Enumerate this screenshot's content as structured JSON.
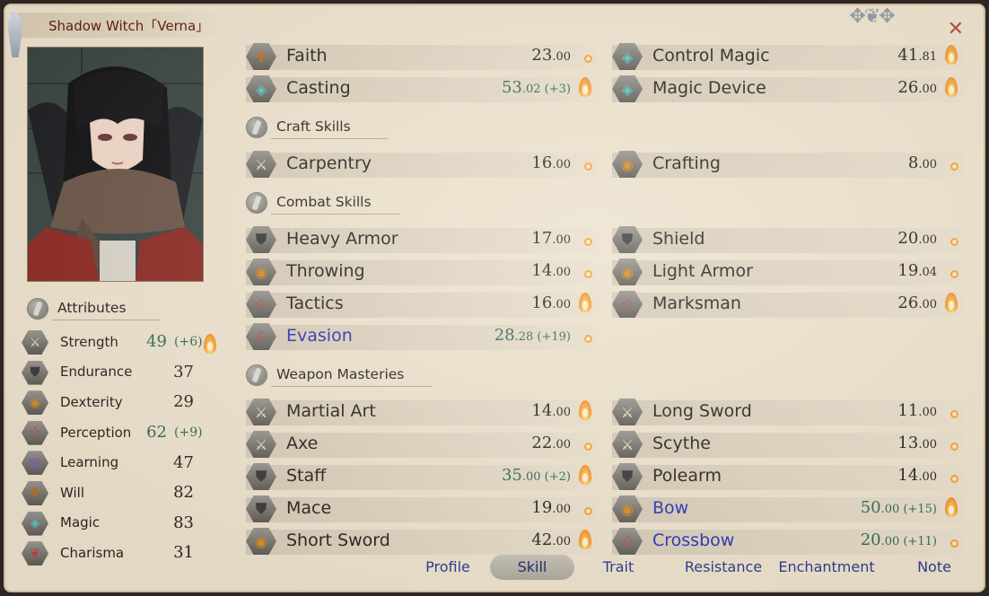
{
  "title": "Shadow Witch「Verna」",
  "attributes_header": "Attributes",
  "attributes": [
    {
      "name": "Strength",
      "value": "49",
      "bonus": "(+6)",
      "icon": "sword-icon",
      "potential": "flame"
    },
    {
      "name": "Endurance",
      "value": "37",
      "bonus": "",
      "icon": "armor-icon",
      "potential": ""
    },
    {
      "name": "Dexterity",
      "value": "29",
      "bonus": "",
      "icon": "dexterity-icon",
      "potential": ""
    },
    {
      "name": "Perception",
      "value": "62",
      "bonus": "(+9)",
      "icon": "perception-icon",
      "potential": ""
    },
    {
      "name": "Learning",
      "value": "47",
      "bonus": "",
      "icon": "book-icon",
      "potential": ""
    },
    {
      "name": "Will",
      "value": "82",
      "bonus": "",
      "icon": "will-icon",
      "potential": ""
    },
    {
      "name": "Magic",
      "value": "83",
      "bonus": "",
      "icon": "magic-icon",
      "potential": ""
    },
    {
      "name": "Charisma",
      "value": "31",
      "bonus": "",
      "icon": "charisma-icon",
      "potential": ""
    }
  ],
  "magic_skills": [
    {
      "name": "Faith",
      "int": "23",
      "dec": ".00",
      "bonus": "",
      "potential": "dot",
      "icon": "will-icon"
    },
    {
      "name": "Control Magic",
      "int": "41",
      "dec": ".81",
      "bonus": "",
      "potential": "flame",
      "icon": "magic-icon"
    },
    {
      "name": "Casting",
      "int": "53",
      "dec": ".02",
      "bonus": "(+3)",
      "potential": "flame",
      "icon": "magic-icon"
    },
    {
      "name": "Magic Device",
      "int": "26",
      "dec": ".00",
      "bonus": "",
      "potential": "flame",
      "icon": "magic-icon"
    }
  ],
  "sections": {
    "craft": "Craft Skills",
    "combat": "Combat Skills",
    "weapon": "Weapon Masteries"
  },
  "craft_skills": [
    {
      "name": "Carpentry",
      "int": "16",
      "dec": ".00",
      "bonus": "",
      "potential": "dot",
      "icon": "sword-icon"
    },
    {
      "name": "Crafting",
      "int": "8",
      "dec": ".00",
      "bonus": "",
      "potential": "dot",
      "icon": "dexterity-icon"
    }
  ],
  "combat_skills": [
    {
      "name": "Heavy Armor",
      "int": "17",
      "dec": ".00",
      "bonus": "",
      "potential": "dot",
      "icon": "armor-icon"
    },
    {
      "name": "Shield",
      "int": "20",
      "dec": ".00",
      "bonus": "",
      "potential": "dot",
      "icon": "armor-icon"
    },
    {
      "name": "Throwing",
      "int": "14",
      "dec": ".00",
      "bonus": "",
      "potential": "dot",
      "icon": "dexterity-icon"
    },
    {
      "name": "Light Armor",
      "int": "19",
      "dec": ".04",
      "bonus": "",
      "potential": "dot",
      "icon": "dexterity-icon"
    },
    {
      "name": "Tactics",
      "int": "16",
      "dec": ".00",
      "bonus": "",
      "potential": "flame",
      "icon": "perception-icon"
    },
    {
      "name": "Marksman",
      "int": "26",
      "dec": ".00",
      "bonus": "",
      "potential": "flame",
      "icon": "perception-icon"
    },
    {
      "name": "Evasion",
      "int": "28",
      "dec": ".28",
      "bonus": "(+19)",
      "potential": "dot",
      "icon": "perception-icon",
      "highlight": true
    }
  ],
  "weapon_skills": [
    {
      "name": "Martial Art",
      "int": "14",
      "dec": ".00",
      "bonus": "",
      "potential": "flame",
      "icon": "sword-icon"
    },
    {
      "name": "Long Sword",
      "int": "11",
      "dec": ".00",
      "bonus": "",
      "potential": "dot",
      "icon": "sword-icon"
    },
    {
      "name": "Axe",
      "int": "22",
      "dec": ".00",
      "bonus": "",
      "potential": "dot",
      "icon": "sword-icon"
    },
    {
      "name": "Scythe",
      "int": "13",
      "dec": ".00",
      "bonus": "",
      "potential": "dot",
      "icon": "sword-icon"
    },
    {
      "name": "Staff",
      "int": "35",
      "dec": ".00",
      "bonus": "(+2)",
      "potential": "flame",
      "icon": "armor-icon"
    },
    {
      "name": "Polearm",
      "int": "14",
      "dec": ".00",
      "bonus": "",
      "potential": "dot",
      "icon": "armor-icon"
    },
    {
      "name": "Mace",
      "int": "19",
      "dec": ".00",
      "bonus": "",
      "potential": "dot",
      "icon": "armor-icon"
    },
    {
      "name": "Bow",
      "int": "50",
      "dec": ".00",
      "bonus": "(+15)",
      "potential": "flame",
      "icon": "dexterity-icon",
      "highlight": true
    },
    {
      "name": "Short Sword",
      "int": "42",
      "dec": ".00",
      "bonus": "",
      "potential": "flame",
      "icon": "dexterity-icon"
    },
    {
      "name": "Crossbow",
      "int": "20",
      "dec": ".00",
      "bonus": "(+11)",
      "potential": "dot",
      "icon": "perception-icon",
      "highlight": true
    }
  ],
  "tabs": [
    "Profile",
    "Skill",
    "Trait",
    "Resistance",
    "Enchantment",
    "Note"
  ],
  "active_tab": "Skill",
  "colors": {
    "potential_skill": "#2c33b6",
    "boosted_value": "#2f6b57",
    "title": "#5a1d12"
  }
}
